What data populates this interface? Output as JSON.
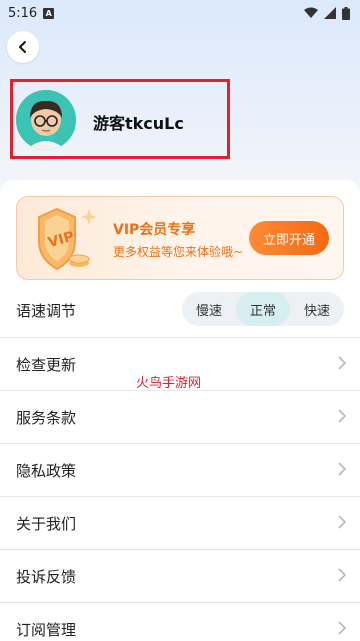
{
  "status_bar": {
    "time": "5:16",
    "notification_letter": "A"
  },
  "header": {
    "username": "游客tkcuLc"
  },
  "vip": {
    "badge_text": "VIP",
    "title": "VIP会员专享",
    "subtitle": "更多权益等您来体验哦~",
    "button_label": "立即开通"
  },
  "speed": {
    "label": "语速调节",
    "options": [
      "慢速",
      "正常",
      "快速"
    ],
    "selected": "正常"
  },
  "menu": {
    "items": [
      {
        "label": "检查更新"
      },
      {
        "label": "服务条款"
      },
      {
        "label": "隐私政策"
      },
      {
        "label": "关于我们"
      },
      {
        "label": "投诉反馈"
      },
      {
        "label": "订阅管理"
      }
    ]
  },
  "watermark": "火鸟手游网",
  "colors": {
    "accent_orange": "#f36a12",
    "highlight_red": "#e0222f",
    "avatar_teal": "#3cc3b4"
  }
}
